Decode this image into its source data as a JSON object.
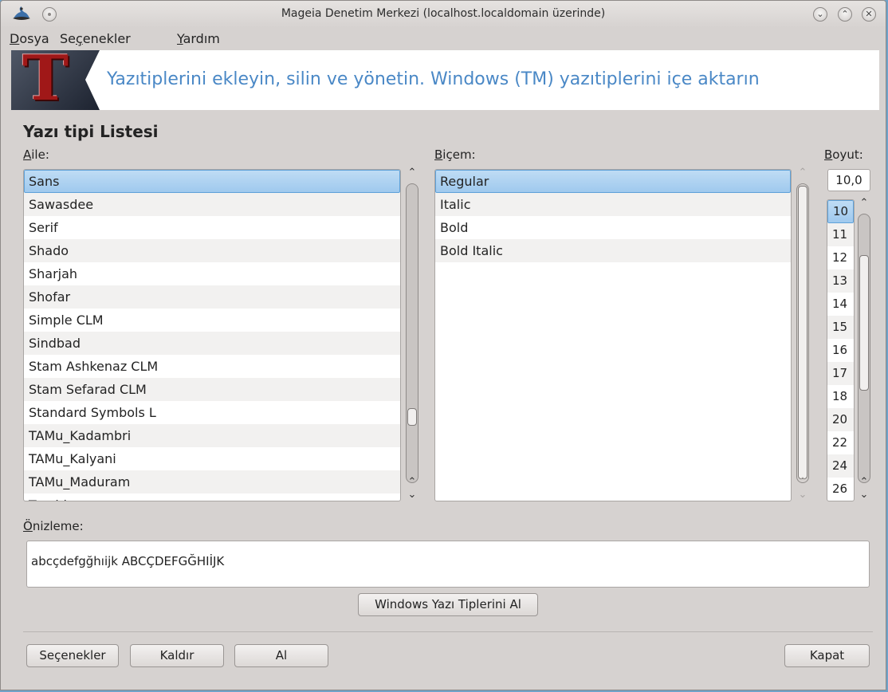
{
  "window": {
    "title": "Mageia Denetim Merkezi  (localhost.localdomain üzerinde)"
  },
  "menu": {
    "dosya": {
      "acc": "D",
      "rest": "osya"
    },
    "secenekler": {
      "pre": "Se",
      "acc": "ç",
      "rest": "enekler"
    },
    "yardim": {
      "acc": "Y",
      "rest": "ardım"
    }
  },
  "banner": {
    "logo_letter": "T",
    "text": "Yazıtiplerini ekleyin, silin ve yönetin. Windows (TM) yazıtiplerini içe aktarın"
  },
  "section_title": "Yazı tipi Listesi",
  "family": {
    "label_acc": "A",
    "label_rest": "ile:",
    "items": [
      "Sans",
      "Sawasdee",
      "Serif",
      "Shado",
      "Sharjah",
      "Shofar",
      "Simple CLM",
      "Sindbad",
      "Stam Ashkenaz CLM",
      "Stam Sefarad CLM",
      "Standard Symbols L",
      "TAMu_Kadambri",
      "TAMu_Kalyani",
      "TAMu_Maduram",
      "Tarablus"
    ],
    "selected": "Sans"
  },
  "style": {
    "label_acc": "B",
    "label_rest": "içem:",
    "items": [
      "Regular",
      "Italic",
      "Bold",
      "Bold Italic"
    ],
    "selected": "Regular"
  },
  "size": {
    "label_acc": "B",
    "label_rest": "oyut:",
    "value": "10,0",
    "items": [
      "10",
      "11",
      "12",
      "13",
      "14",
      "15",
      "16",
      "17",
      "18",
      "20",
      "22",
      "24",
      "26"
    ],
    "selected": "10"
  },
  "preview": {
    "label_acc": "Ö",
    "label_rest": "nizleme:",
    "text": "abcçdefgğhıijk ABCÇDEFGĞHIİJK"
  },
  "buttons": {
    "import_windows": "Windows Yazı Tiplerini Al",
    "options": "Seçenekler",
    "remove": "Kaldır",
    "get": "Al",
    "close": "Kapat"
  },
  "colors": {
    "accent": "#4a88c6",
    "selection": "#9fc9ee",
    "window_bg": "#d6d2d0",
    "desktop": "#6fa3c9"
  },
  "icons": {
    "app": "mageia-hat-icon",
    "pin": "pin-icon",
    "minimize": "chevron-down-icon",
    "maximize": "chevron-up-icon",
    "close": "close-icon",
    "scroll_up": "chevron-up-icon",
    "scroll_down": "chevron-down-icon"
  }
}
